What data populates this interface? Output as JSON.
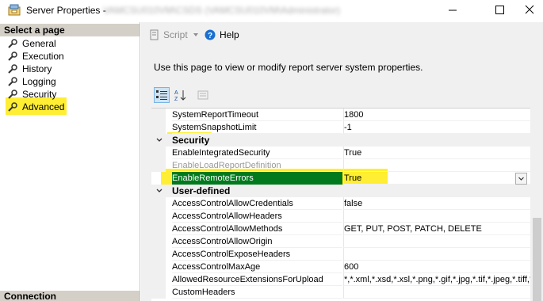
{
  "window": {
    "title": "Server Properties -",
    "title_obscured": "VAMCSU010VM\\CSDS (VAMCSU010VM\\Administrator)"
  },
  "left_pane": {
    "header": "Select a page",
    "items": [
      {
        "label": "General"
      },
      {
        "label": "Execution"
      },
      {
        "label": "History"
      },
      {
        "label": "Logging"
      },
      {
        "label": "Security"
      },
      {
        "label": "Advanced",
        "selected": true
      }
    ],
    "footer": "Connection"
  },
  "toolbar": {
    "script_label": "Script",
    "help_label": "Help"
  },
  "description": "Use this page to view or modify report server system properties.",
  "property_grid": {
    "rows": [
      {
        "kind": "prop",
        "name": "SystemReportTimeout",
        "value": "1800"
      },
      {
        "kind": "prop",
        "name": "SystemSnapshotLimit",
        "value": "-1"
      },
      {
        "kind": "category",
        "name": "Security"
      },
      {
        "kind": "prop",
        "name": "EnableIntegratedSecurity",
        "value": "True"
      },
      {
        "kind": "prop",
        "name": "EnableLoadReportDefinition",
        "value": "",
        "disabled": true
      },
      {
        "kind": "prop",
        "name": "EnableRemoteErrors",
        "value": "True",
        "selected": true
      },
      {
        "kind": "category",
        "name": "User-defined"
      },
      {
        "kind": "prop",
        "name": "AccessControlAllowCredentials",
        "value": "false"
      },
      {
        "kind": "prop",
        "name": "AccessControlAllowHeaders",
        "value": ""
      },
      {
        "kind": "prop",
        "name": "AccessControlAllowMethods",
        "value": "GET, PUT, POST, PATCH, DELETE"
      },
      {
        "kind": "prop",
        "name": "AccessControlAllowOrigin",
        "value": ""
      },
      {
        "kind": "prop",
        "name": "AccessControlExposeHeaders",
        "value": ""
      },
      {
        "kind": "prop",
        "name": "AccessControlMaxAge",
        "value": "600"
      },
      {
        "kind": "prop",
        "name": "AllowedResourceExtensionsForUpload",
        "value": "*,*.xml,*.xsd,*.xsl,*.png,*.gif,*.jpg,*.tif,*.jpeg,*.tiff,*.b"
      },
      {
        "kind": "prop",
        "name": "CustomHeaders",
        "value": ""
      }
    ]
  },
  "colors": {
    "highlight": "#ffee33",
    "selected_row": "#007a1c",
    "panel_bg": "#f0f0f0",
    "header_bg": "#d4d0c8"
  }
}
